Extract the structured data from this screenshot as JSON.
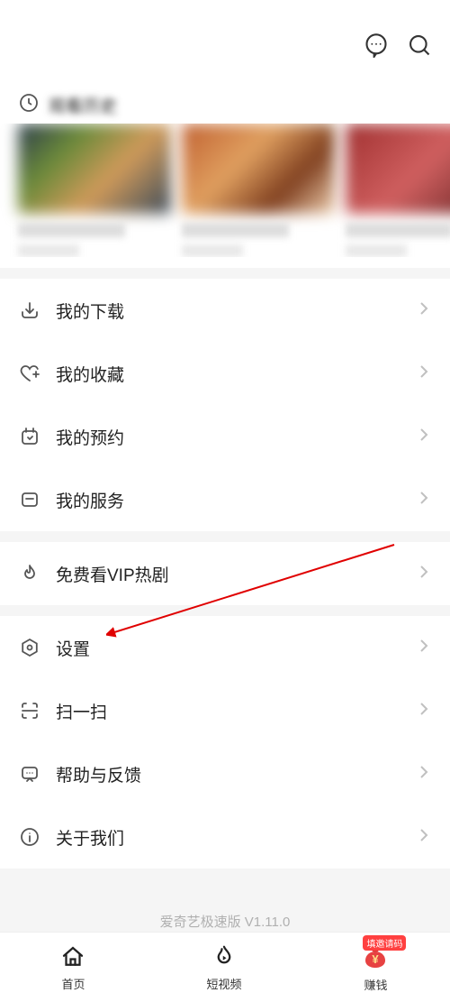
{
  "menu": {
    "downloads": "我的下载",
    "favorites": "我的收藏",
    "reservations": "我的预约",
    "services": "我的服务",
    "free_vip": "免费看VIP热剧",
    "settings": "设置",
    "scan": "扫一扫",
    "help_feedback": "帮助与反馈",
    "about": "关于我们"
  },
  "version_line": "爱奇艺极速版 V1.11.0",
  "nav": {
    "home": "首页",
    "short_video": "短视频",
    "earn": "赚钱",
    "earn_badge": "填邀请码"
  }
}
